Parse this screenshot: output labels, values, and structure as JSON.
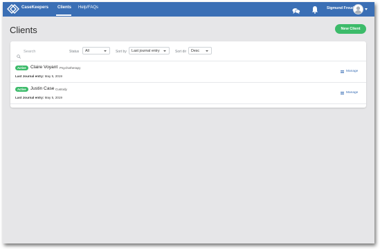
{
  "app": {
    "brand": "CaseKeepers"
  },
  "nav": {
    "items": [
      {
        "label": "Clients",
        "active": true
      },
      {
        "label": "Help/FAQs",
        "active": false
      }
    ],
    "icons": [
      "chat-bubbles-icon",
      "bell-icon",
      "user-avatar-icon",
      "chevron-down-icon"
    ],
    "user_name": "Sigmund Freud"
  },
  "page": {
    "title": "Clients",
    "new_client_label": "New Client"
  },
  "filters": {
    "search_placeholder": "Search",
    "status_label": "Status",
    "status_value": "All",
    "sort_by_label": "Sort by",
    "sort_by_value": "Last journal entry",
    "sort_dir_label": "Sort dir",
    "sort_dir_value": "Desc"
  },
  "clients": [
    {
      "status": "Active",
      "name": "Claire Voyant",
      "type": "Psychotherapy",
      "last_entry_label": "Last Journal entry:",
      "last_entry_date": "May 5, 2019",
      "manage_label": "Manage"
    },
    {
      "status": "Active",
      "name": "Justin Case",
      "type": "Custody",
      "last_entry_label": "Last Journal entry:",
      "last_entry_date": "May 5, 2019",
      "manage_label": "Manage"
    }
  ],
  "colors": {
    "nav_bg": "#3b6fb5",
    "page_bg": "#e6e6e8",
    "accent_green": "#3cbb6a",
    "link_blue": "#3b6fb5"
  }
}
